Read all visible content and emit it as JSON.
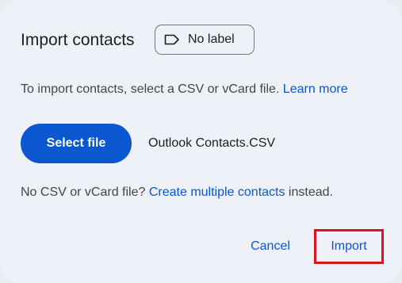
{
  "dialog": {
    "title": "Import contacts",
    "label_chip": {
      "icon": "label-outline-icon",
      "text": "No label"
    },
    "description": {
      "text": "To import contacts, select a CSV or vCard file. ",
      "link": "Learn more"
    },
    "select_file_button": "Select file",
    "selected_file": "Outlook Contacts.CSV",
    "no_file": {
      "prefix": "No CSV or vCard file? ",
      "link": "Create multiple contacts",
      "suffix": " instead."
    },
    "actions": {
      "cancel": "Cancel",
      "import": "Import"
    }
  },
  "colors": {
    "primary": "#0b57d0",
    "surface": "#eef1f7",
    "highlight_border": "#d7141f"
  }
}
